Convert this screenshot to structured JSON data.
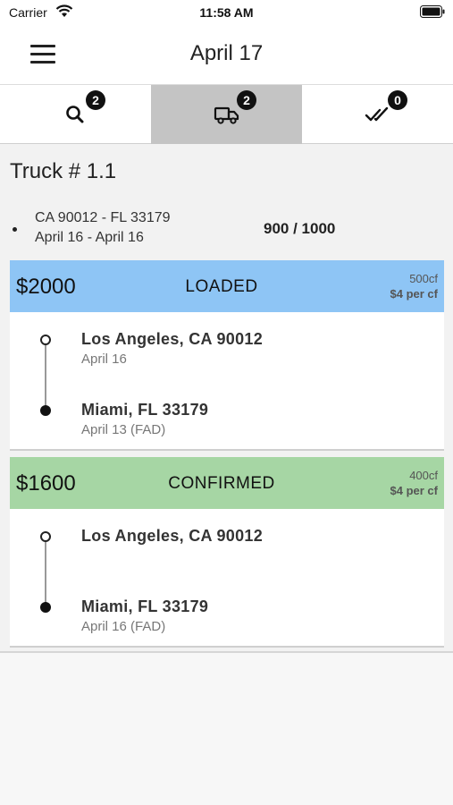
{
  "status_bar": {
    "carrier": "Carrier",
    "time": "11:58 AM"
  },
  "header": {
    "title": "April 17",
    "menu_icon": "hamburger-menu-icon"
  },
  "tabs": [
    {
      "name": "search",
      "icon": "search-icon",
      "badge": "2",
      "active": false
    },
    {
      "name": "trucks",
      "icon": "truck-icon",
      "badge": "2",
      "active": true
    },
    {
      "name": "delivered",
      "icon": "double-check-icon",
      "badge": "0",
      "active": false
    }
  ],
  "truck": {
    "title": "Truck # 1.1",
    "route": "CA 90012 - FL 33179",
    "dates": "April 16 - April 16",
    "capacity": "900 / 1000"
  },
  "loads": [
    {
      "price": "$2000",
      "status": "LOADED",
      "volume": "500cf",
      "rate": "$4 per cf",
      "header_color": "#8ec5f5",
      "origin_city": "Los Angeles, CA 90012",
      "origin_date": "April 16",
      "dest_city": "Miami, FL 33179",
      "dest_date": "April 13 (FAD)"
    },
    {
      "price": "$1600",
      "status": "CONFIRMED",
      "volume": "400cf",
      "rate": "$4 per cf",
      "header_color": "#a6d6a4",
      "origin_city": "Los Angeles, CA 90012",
      "origin_date": "",
      "dest_city": "Miami, FL 33179",
      "dest_date": "April 16 (FAD)"
    }
  ],
  "colors": {
    "active_tab": "#c4c4c4",
    "badge": "#111111",
    "background": "#f2f2f2"
  }
}
